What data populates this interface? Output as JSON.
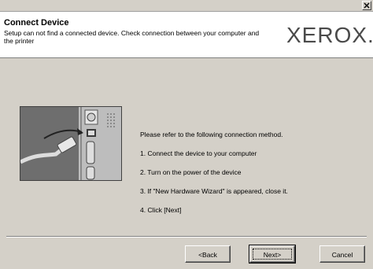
{
  "window": {
    "close_icon": "close-icon"
  },
  "header": {
    "title": "Connect Device",
    "description": "Setup can not find a connected device. Check connection between your computer and the printer",
    "logo": "XEROX."
  },
  "instructions": {
    "intro": "Please refer to the following connection method.",
    "steps": [
      "1. Connect the device to your computer",
      "2. Turn on the power of the device",
      "3. If \"New Hardware Wizard\" is appeared, close it.",
      "4. Click [Next]"
    ]
  },
  "buttons": {
    "back": "<Back",
    "next": "Next>",
    "cancel": "Cancel"
  }
}
